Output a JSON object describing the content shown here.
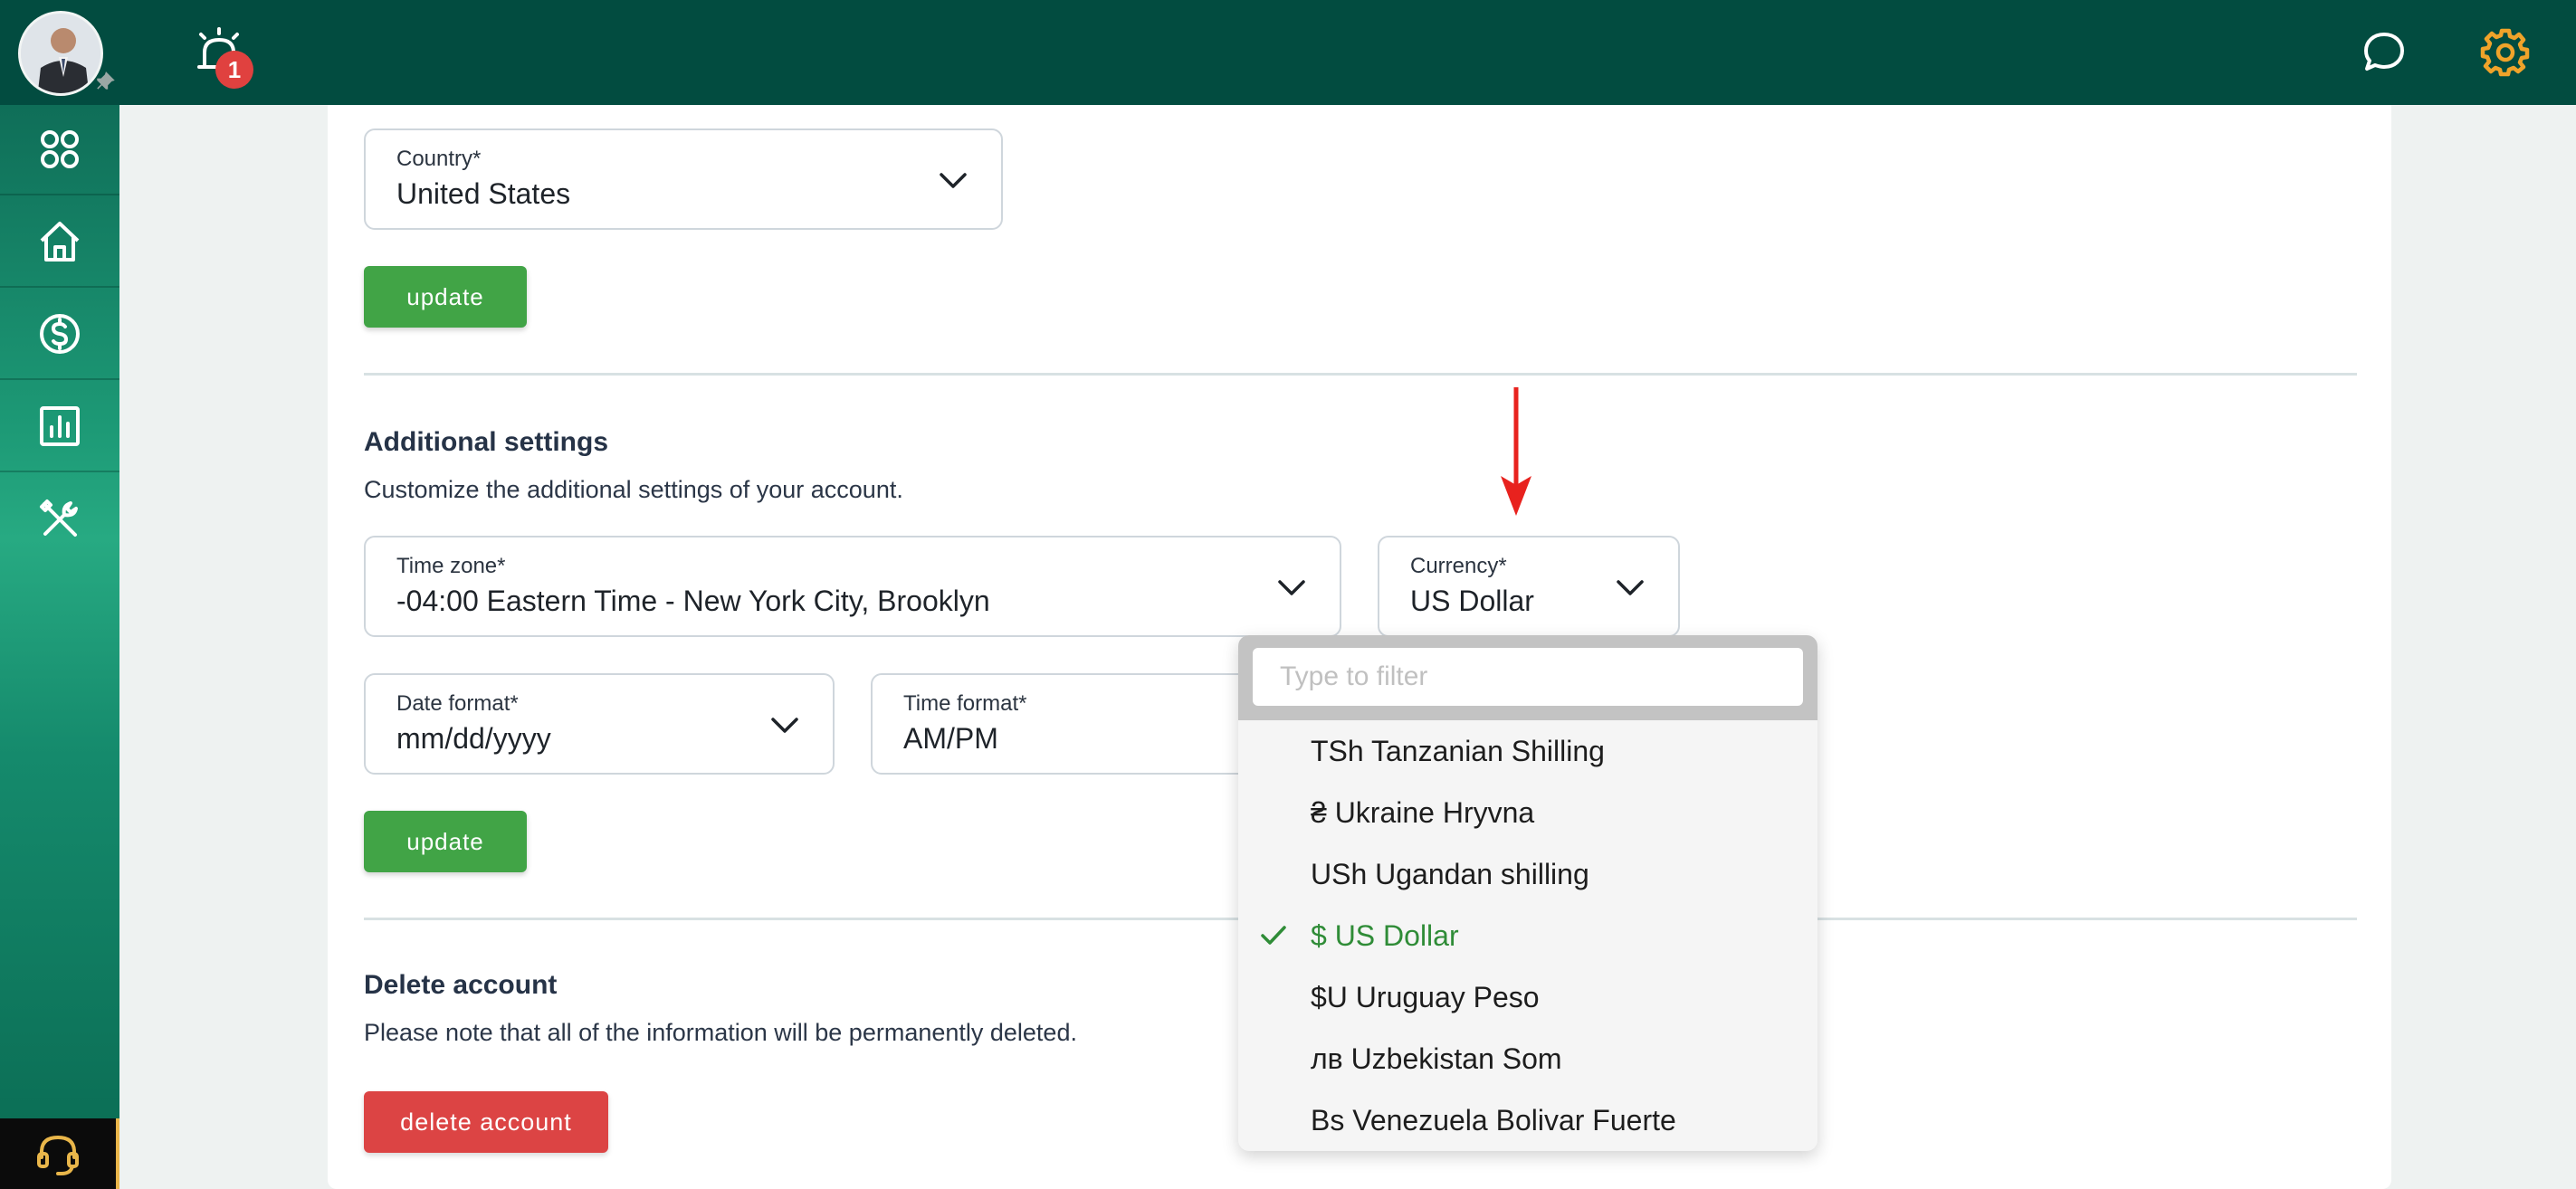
{
  "header": {
    "notification_count": "1"
  },
  "country": {
    "label": "Country*",
    "value": "United States",
    "update_label": "update"
  },
  "additional": {
    "title": "Additional settings",
    "description": "Customize the additional settings of your account.",
    "timezone": {
      "label": "Time zone*",
      "value": "-04:00 Eastern Time - New York City, Brooklyn"
    },
    "currency": {
      "label": "Currency*",
      "value": "US Dollar"
    },
    "date_format": {
      "label": "Date format*",
      "value": "mm/dd/yyyy"
    },
    "time_format": {
      "label": "Time format*",
      "value": "AM/PM"
    },
    "update_label": "update"
  },
  "delete": {
    "title": "Delete account",
    "description": "Please note that all of the information will be permanently deleted.",
    "button_label": "delete account"
  },
  "currency_dropdown": {
    "filter_placeholder": "Type to filter",
    "selected": "$ US Dollar",
    "options": [
      "TSh Tanzanian Shilling",
      "₴ Ukraine Hryvna",
      "USh Ugandan shilling",
      "$ US Dollar",
      "$U Uruguay Peso",
      "лв Uzbekistan Som",
      "Bs Venezuela Bolivar Fuerte"
    ]
  },
  "colors": {
    "topbar": "#024c40",
    "accent_green": "#41a446",
    "danger_red": "#dc4444",
    "gear_orange": "#f0a32a",
    "selected_text": "#2f8c37"
  },
  "icons": {
    "sidebar": [
      "apps-grid-icon",
      "home-icon",
      "dollar-circle-icon",
      "bar-chart-icon",
      "tools-icon"
    ],
    "support": "headset-icon",
    "header": [
      "alarm-bell-icon",
      "chat-bubble-icon",
      "gear-icon"
    ]
  }
}
